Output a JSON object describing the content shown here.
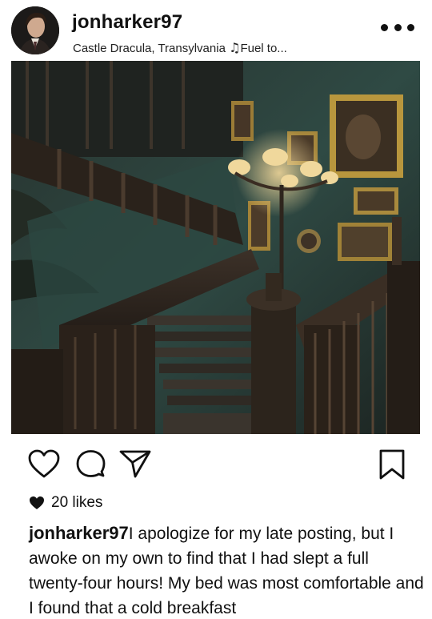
{
  "post": {
    "username": "jonharker97",
    "location": "Castle Dracula, Transylvania",
    "song_icon": "music-note-icon",
    "song": "Fuel to...",
    "more_icon": "more-horizontal-icon",
    "image_alt": "Gothic castle interior with dark carved wooden staircase and gilded portrait paintings"
  },
  "actions": {
    "like_icon": "heart-outline-icon",
    "comment_icon": "comment-bubble-icon",
    "share_icon": "paper-plane-icon",
    "save_icon": "bookmark-icon"
  },
  "likes": {
    "icon": "heart-filled-icon",
    "text": "20 likes"
  },
  "caption": {
    "username": "jonharker97",
    "text": "I apologize for my late posting, but I awoke on my own to find that I had slept a full twenty-four hours! My bed was most comfortable and I found that a cold breakfast"
  }
}
